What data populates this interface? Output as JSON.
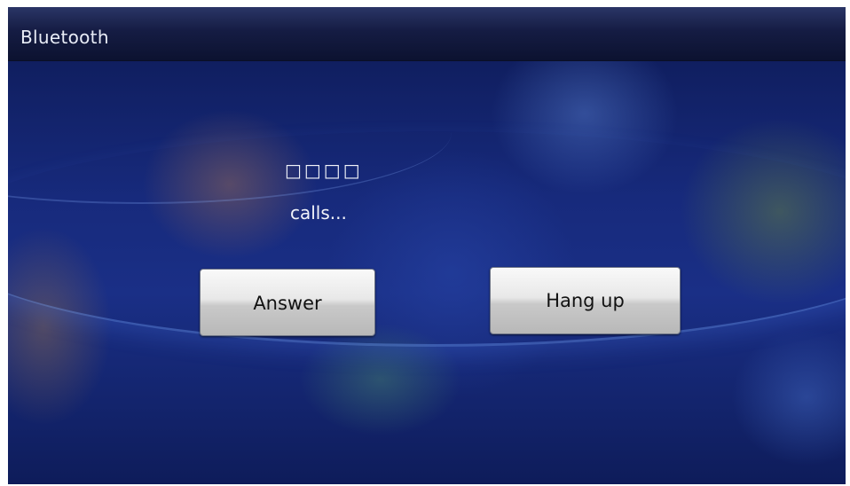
{
  "window": {
    "title": "Bluetooth"
  },
  "call": {
    "caller": "□□□□",
    "status": "calls..."
  },
  "buttons": {
    "answer_label": "Answer",
    "hangup_label": "Hang up"
  },
  "colors": {
    "background": "#172a7c",
    "titlebar": "#151c43",
    "text": "#f2f4fa",
    "button_face": "#e8e8e8"
  }
}
